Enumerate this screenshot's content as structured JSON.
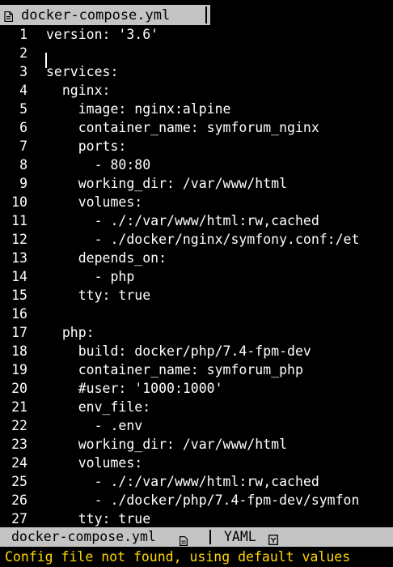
{
  "tab": {
    "filename": "docker-compose.yml",
    "icon": "document-icon"
  },
  "editor": {
    "lines": [
      {
        "num": "1",
        "text": "version: '3.6'"
      },
      {
        "num": "2",
        "text": ""
      },
      {
        "num": "3",
        "text": "services:"
      },
      {
        "num": "4",
        "text": "  nginx:"
      },
      {
        "num": "5",
        "text": "    image: nginx:alpine"
      },
      {
        "num": "6",
        "text": "    container_name: symforum_nginx"
      },
      {
        "num": "7",
        "text": "    ports:"
      },
      {
        "num": "8",
        "text": "      - 80:80"
      },
      {
        "num": "9",
        "text": "    working_dir: /var/www/html"
      },
      {
        "num": "10",
        "text": "    volumes:"
      },
      {
        "num": "11",
        "text": "      - ./:/var/www/html:rw,cached"
      },
      {
        "num": "12",
        "text": "      - ./docker/nginx/symfony.conf:/et"
      },
      {
        "num": "13",
        "text": "    depends_on:"
      },
      {
        "num": "14",
        "text": "      - php"
      },
      {
        "num": "15",
        "text": "    tty: true"
      },
      {
        "num": "16",
        "text": ""
      },
      {
        "num": "17",
        "text": "  php:"
      },
      {
        "num": "18",
        "text": "    build: docker/php/7.4-fpm-dev"
      },
      {
        "num": "19",
        "text": "    container_name: symforum_php"
      },
      {
        "num": "20",
        "text": "    #user: '1000:1000'"
      },
      {
        "num": "21",
        "text": "    env_file:"
      },
      {
        "num": "22",
        "text": "      - .env"
      },
      {
        "num": "23",
        "text": "    working_dir: /var/www/html"
      },
      {
        "num": "24",
        "text": "    volumes:"
      },
      {
        "num": "25",
        "text": "      - ./:/var/www/html:rw,cached"
      },
      {
        "num": "26",
        "text": "      - ./docker/php/7.4-fpm-dev/symfon"
      },
      {
        "num": "27",
        "text": "    tty: true"
      }
    ]
  },
  "status": {
    "filename": "docker-compose.yml",
    "file_icon": "document-icon",
    "language": "YAML",
    "language_icon": "yaml-icon"
  },
  "message": {
    "text": "Config file not found, using default values"
  },
  "colors": {
    "background": "#000000",
    "foreground": "#ffffff",
    "bar_background": "#c4c4c4",
    "bar_foreground": "#000000",
    "message_foreground": "#ffd700"
  }
}
